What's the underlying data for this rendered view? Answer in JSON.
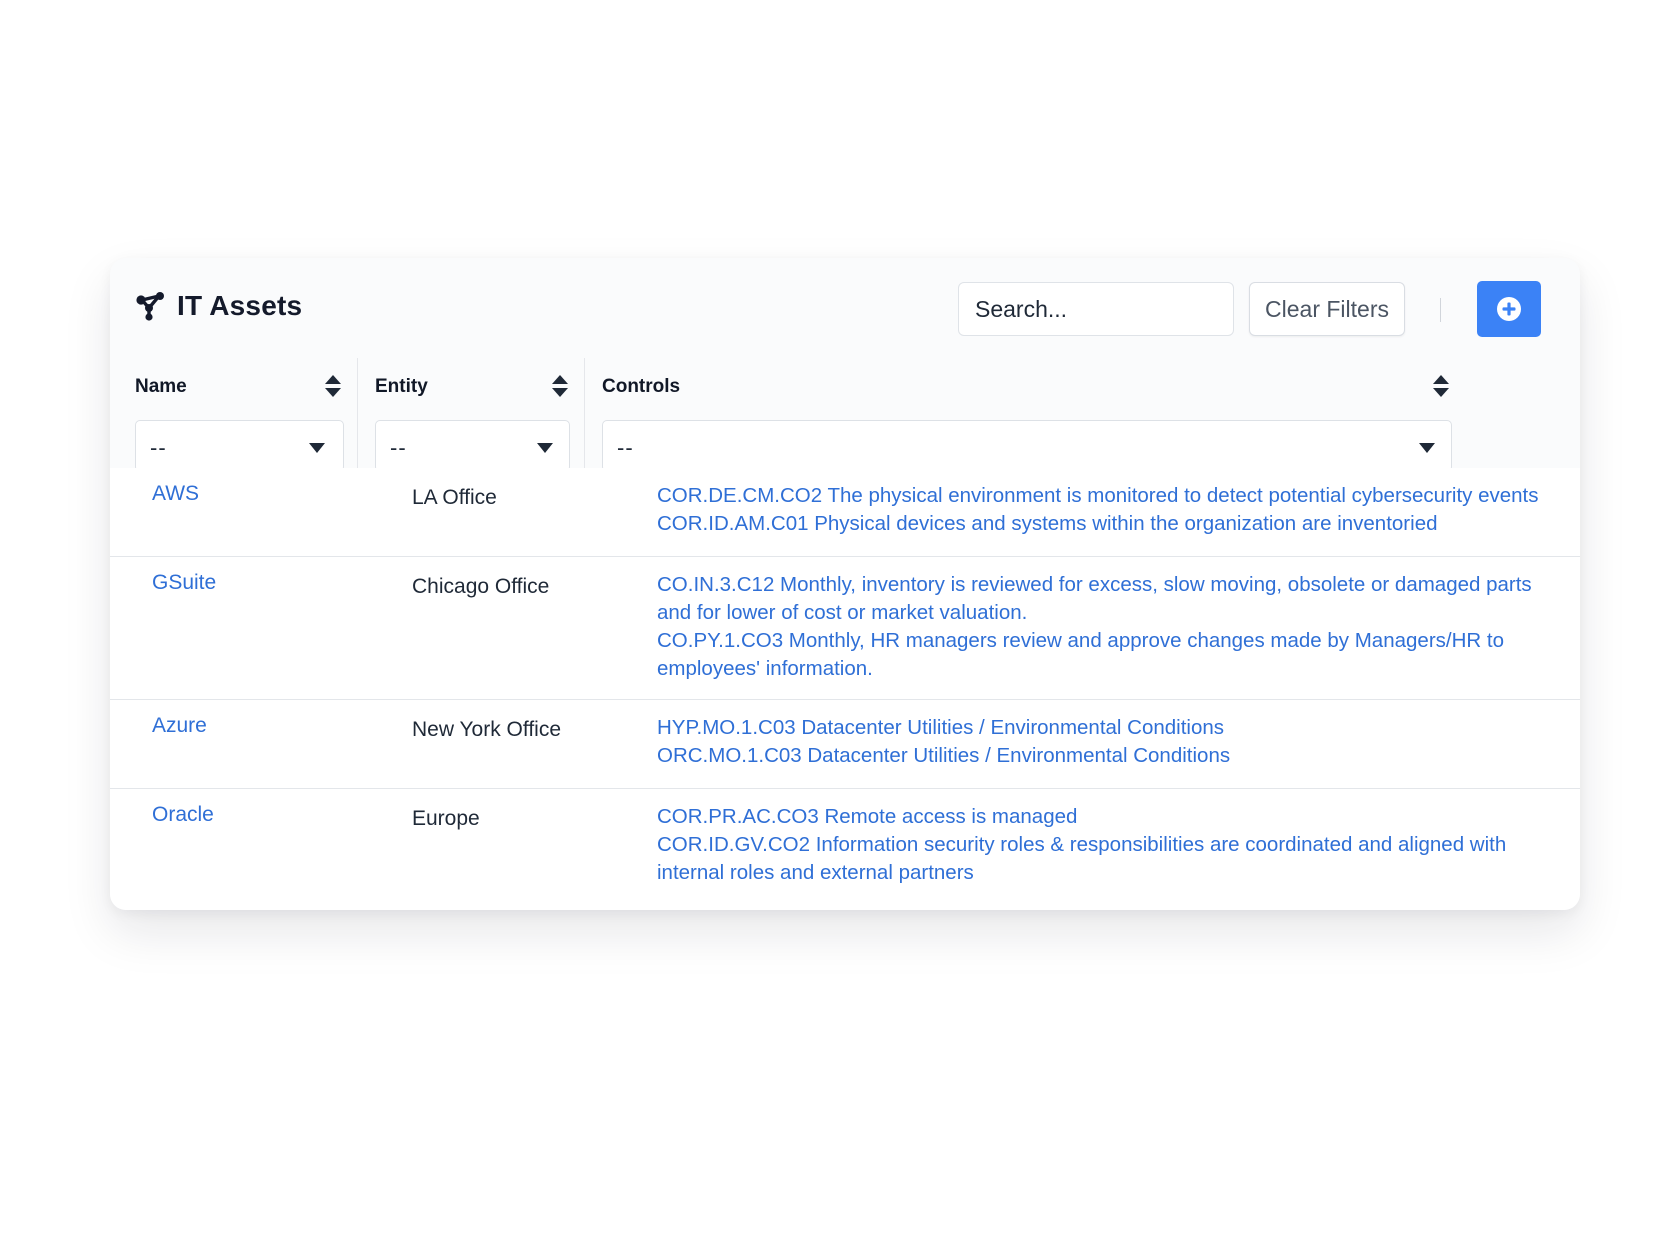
{
  "header": {
    "title": "IT Assets",
    "icon": "share-nodes-icon",
    "search_placeholder": "Search...",
    "clear_filters_label": "Clear Filters",
    "add_icon": "plus-circle-icon"
  },
  "columns": [
    {
      "label": "Name",
      "filter_value": "--"
    },
    {
      "label": "Entity",
      "filter_value": "--"
    },
    {
      "label": "Controls",
      "filter_value": "--"
    }
  ],
  "rows": [
    {
      "name": "AWS",
      "entity": "LA Office",
      "controls": [
        "COR.DE.CM.CO2 The physical environment is monitored to detect potential cybersecurity events",
        "COR.ID.AM.C01 Physical devices and systems within the organization are inventoried"
      ]
    },
    {
      "name": "GSuite",
      "entity": "Chicago Office",
      "controls": [
        "CO.IN.3.C12 Monthly, inventory is reviewed for excess, slow moving, obsolete or damaged parts and for lower of cost or market valuation.",
        "CO.PY.1.CO3 Monthly, HR managers review and approve changes made by Managers/HR to employees' information."
      ]
    },
    {
      "name": "Azure",
      "entity": "New York Office",
      "controls": [
        "HYP.MO.1.C03 Datacenter Utilities / Environmental Conditions",
        "ORC.MO.1.C03 Datacenter Utilities / Environmental Conditions"
      ]
    },
    {
      "name": "Oracle",
      "entity": "Europe",
      "controls": [
        "COR.PR.AC.CO3 Remote access is managed",
        "COR.ID.GV.CO2 Information security roles & responsibilities are coordinated and aligned with internal roles and external partners"
      ]
    }
  ],
  "colors": {
    "link": "#2f6fd6",
    "primary_button": "#3b82f6",
    "title_text": "#141a2b"
  }
}
